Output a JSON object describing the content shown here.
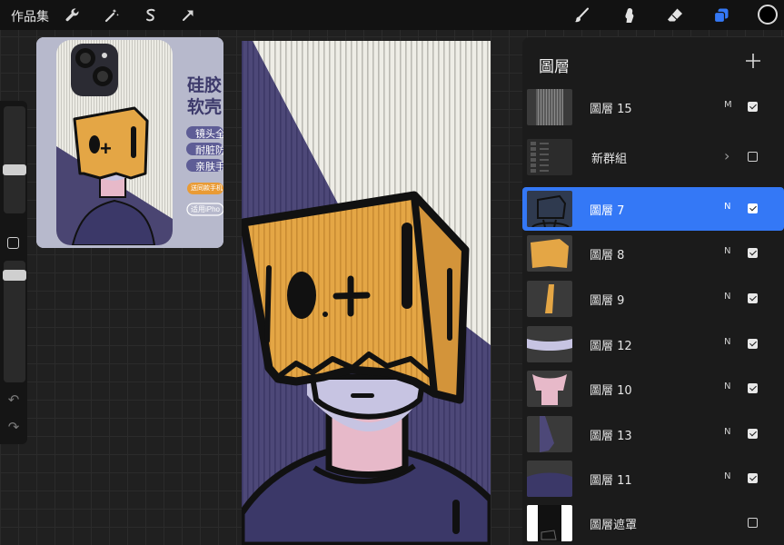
{
  "toolbar": {
    "gallery_label": "作品集",
    "left_tools": [
      "wrench-icon",
      "magic-wand-icon",
      "selection-icon",
      "transform-arrow-icon"
    ],
    "right_tools": [
      "brush-icon",
      "smudge-icon",
      "eraser-icon",
      "layers-icon"
    ],
    "current_color": "#000000",
    "accent": "#3478f6"
  },
  "reference": {
    "line1": "硅胶",
    "line2": "软壳",
    "pill1": "镜头全",
    "pill2": "耐脏防",
    "pill3": "亲肤手",
    "tag1": "送同款手机",
    "tag2": "适用iPho"
  },
  "canvas_art": {
    "face_mark": "0.+"
  },
  "layers": {
    "title": "圖層",
    "items": [
      {
        "name": "圖層 15",
        "mode": "M",
        "visible": true,
        "active": false,
        "thumb": "stripes"
      },
      {
        "name": "新群組",
        "mode": "",
        "visible": false,
        "active": false,
        "group": true,
        "thumb": "group"
      },
      {
        "name": "圖層 7",
        "mode": "N",
        "visible": true,
        "active": true,
        "thumb": "outline"
      },
      {
        "name": "圖層 8",
        "mode": "N",
        "visible": true,
        "active": false,
        "thumb": "orange"
      },
      {
        "name": "圖層 9",
        "mode": "N",
        "visible": true,
        "active": false,
        "thumb": "shard"
      },
      {
        "name": "圖層 12",
        "mode": "N",
        "visible": true,
        "active": false,
        "thumb": "lavender"
      },
      {
        "name": "圖層 10",
        "mode": "N",
        "visible": true,
        "active": false,
        "thumb": "pink"
      },
      {
        "name": "圖層 13",
        "mode": "N",
        "visible": true,
        "active": false,
        "thumb": "navytri"
      },
      {
        "name": "圖層 11",
        "mode": "N",
        "visible": true,
        "active": false,
        "thumb": "navy"
      },
      {
        "name": "圖層遮罩",
        "mode": "",
        "visible": false,
        "active": false,
        "thumb": "mask"
      }
    ]
  }
}
